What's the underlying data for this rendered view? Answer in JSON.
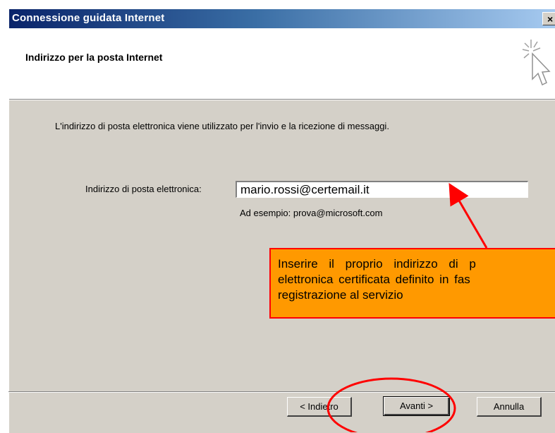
{
  "window": {
    "title": "Connessione guidata Internet",
    "close_glyph": "×"
  },
  "header": {
    "title": "Indirizzo per la posta Internet",
    "icon": "wizard-sparkle-cursor-icon"
  },
  "content": {
    "description": "L'indirizzo di posta elettronica viene utilizzato per l'invio e la ricezione di messaggi.",
    "email_label": "Indirizzo di posta elettronica:",
    "email_value": "mario.rossi@certemail.it",
    "example_text": "Ad esempio: prova@microsoft.com"
  },
  "callout": {
    "line1": "Inserire il proprio indirizzo di p",
    "line2": "elettronica certificata definito in fas",
    "line3": "registrazione al servizio",
    "background_color": "#ff9900",
    "arrow_color": "#ff0000"
  },
  "buttons": {
    "back_label": "< Indietro",
    "next_label": "Avanti >",
    "cancel_label": "Annulla"
  },
  "colors": {
    "titlebar_start": "#0a246a",
    "titlebar_end": "#a6caf0",
    "dialog_face": "#d4d0c8",
    "highlight_circle": "#ff0000"
  }
}
